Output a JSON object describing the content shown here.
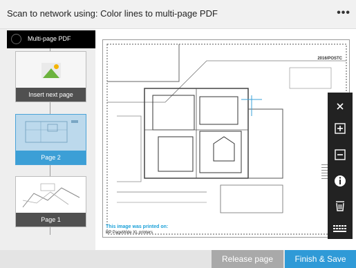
{
  "header": {
    "title": "Scan to network using: Color lines to multi-page PDF",
    "more_label": "•••"
  },
  "sidebar": {
    "job_label": "Multi-page PDF",
    "thumbnails": [
      {
        "caption": "Insert next page",
        "icon": "image-placeholder-icon"
      },
      {
        "caption": "Page 2",
        "selected": true
      },
      {
        "caption": "Page 1"
      }
    ]
  },
  "preview": {
    "stamp": "2016/POSTC",
    "note": "This image was printed on:",
    "note_sub": "HP PageWide XL printers"
  },
  "toolbar": {
    "tools": [
      "close-icon",
      "zoom-in-icon",
      "zoom-out-icon",
      "info-icon",
      "delete-icon",
      "keyboard-icon"
    ]
  },
  "footer": {
    "release_label": "Release page",
    "finish_label": "Finish & Save"
  },
  "colors": {
    "accent": "#2f9ad7",
    "selected_thumb": "#3c9fd6",
    "toolbar": "#222222",
    "secondary_button": "#a9a9a9"
  }
}
